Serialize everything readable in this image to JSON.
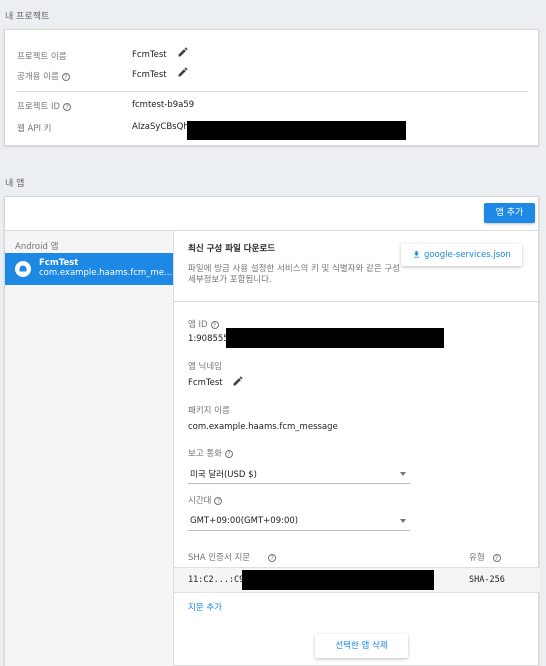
{
  "project_section": {
    "title": "내 프로젝트",
    "rows": [
      {
        "label": "프로젝트 이름",
        "value": "FcmTest",
        "editable": true,
        "help": false
      },
      {
        "label": "공개용 이름",
        "value": "FcmTest",
        "editable": true,
        "help": true
      },
      {
        "label": "프로젝트 ID",
        "value": "fcmtest-b9a59",
        "editable": false,
        "help": true
      },
      {
        "label": "웹 API 키",
        "value": "AIzaSyCBsQh",
        "editable": false,
        "help": false,
        "redacted": true
      }
    ]
  },
  "apps_section": {
    "title": "내 앱",
    "add_app_label": "앱 추가",
    "sidebar": {
      "group_label": "Android 앱",
      "selected_app": {
        "name": "FcmTest",
        "package": "com.example.haams.fcm_me..."
      }
    },
    "detail": {
      "download_title": "최신 구성 파일 다운로드",
      "download_desc": "파일에 방금 사용 설정한 서비스의 키 및 식별자와 같은 구성 세부정보가 포함됩니다.",
      "download_button": "google-services.json",
      "app_id_label": "앱 ID",
      "app_id_value": "1:908555",
      "nickname_label": "앱 닉네임",
      "nickname_value": "FcmTest",
      "package_label": "패키지 이름",
      "package_value": "com.example.haams.fcm_message",
      "currency_label": "보고 통화",
      "currency_value": "미국 달러(USD $)",
      "timezone_label": "시간대",
      "timezone_value": "GMT+09:00(GMT+09:00)",
      "sha_header": "SHA 인증서 지문",
      "type_header": "유형",
      "sha_value": "11:C2...:C9",
      "sha_type": "SHA-256",
      "add_fingerprint": "지문 추가",
      "delete_app": "선택한 앱 삭제"
    }
  },
  "colors": {
    "accent": "#1e88e5",
    "background": "#eceff1",
    "card": "#ffffff"
  },
  "icons": [
    "pencil-icon",
    "help-icon",
    "android-icon",
    "download-icon",
    "chevron-down-icon"
  ]
}
